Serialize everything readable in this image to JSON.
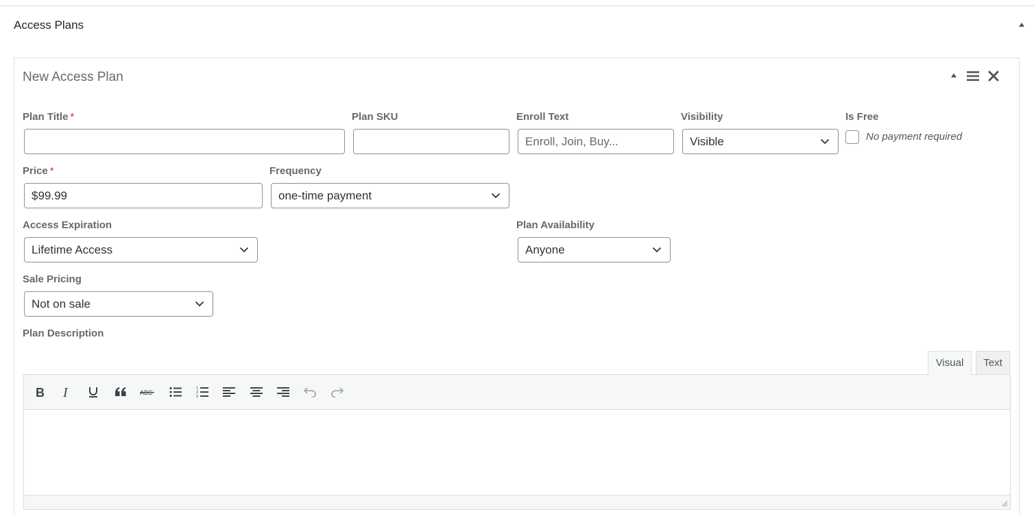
{
  "metabox": {
    "title": "Access Plans",
    "toggle_icon": "triangle-up-icon"
  },
  "plan": {
    "title": "New Access Plan",
    "controls": [
      "collapse-icon",
      "menu-icon",
      "close-icon"
    ]
  },
  "fields": {
    "plan_title": {
      "label": "Plan Title",
      "required": "*",
      "value": ""
    },
    "plan_sku": {
      "label": "Plan SKU",
      "value": ""
    },
    "enroll_text": {
      "label": "Enroll Text",
      "value": "",
      "placeholder": "Enroll, Join, Buy..."
    },
    "visibility": {
      "label": "Visibility",
      "selected": "Visible"
    },
    "is_free": {
      "label": "Is Free",
      "checked": false,
      "note": "No payment required"
    },
    "price": {
      "label": "Price",
      "required": "*",
      "value": "$99.99"
    },
    "frequency": {
      "label": "Frequency",
      "selected": "one-time payment"
    },
    "access_expiration": {
      "label": "Access Expiration",
      "selected": "Lifetime Access"
    },
    "plan_availability": {
      "label": "Plan Availability",
      "selected": "Anyone"
    },
    "sale_pricing": {
      "label": "Sale Pricing",
      "selected": "Not on sale"
    },
    "plan_description": {
      "label": "Plan Description",
      "content": ""
    }
  },
  "editor": {
    "tabs": [
      {
        "label": "Visual",
        "active": true
      },
      {
        "label": "Text",
        "active": false
      }
    ],
    "toolbar": [
      "bold-icon",
      "italic-icon",
      "underline-icon",
      "blockquote-icon",
      "strikethrough-icon",
      "bullet-list-icon",
      "numbered-list-icon",
      "align-left-icon",
      "align-center-icon",
      "align-right-icon",
      "undo-icon",
      "redo-icon"
    ]
  },
  "colors": {
    "required": "#c0392b",
    "label": "#646970",
    "border": "#8c8f94"
  }
}
